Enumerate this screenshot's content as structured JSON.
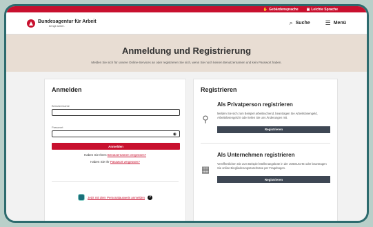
{
  "topbar": {
    "sign_language": "Gebärdensprache",
    "easy_language": "Leichte Sprache"
  },
  "header": {
    "org_name": "Bundesagentur für Arbeit",
    "tagline": "bringt weiter.",
    "search_label": "Suche",
    "menu_label": "Menü"
  },
  "hero": {
    "title": "Anmeldung und Registrierung",
    "subtitle": "Melden Sie sich für unsere Online-Services an oder registrieren Sie sich, wenn Sie noch keinen Benutzernamen und kein Passwort haben."
  },
  "login": {
    "heading": "Anmelden",
    "username_label": "Benutzername",
    "username_value": "",
    "password_label": "Passwort",
    "password_value": "",
    "submit_label": "Anmelden",
    "forgot_user_prefix": "Haben Sie Ihren ",
    "forgot_user_link": "Benutzernamen vergessen?",
    "forgot_pw_prefix": "Haben Sie Ihr ",
    "forgot_pw_link": "Passwort vergessen?",
    "eid_link": "Jetzt mit dem Personalausweis anmelden",
    "eid_help": "?"
  },
  "register": {
    "heading": "Registrieren",
    "private": {
      "title": "Als Privatperson registrieren",
      "text": "Melden Sie sich zum Beispiel arbeitsuchend, beantragen Sie Arbeitslosengeld, Arbeitslosengeld II oder teilen Sie uns Änderungen mit.",
      "button": "Registrieren",
      "icon": "person-icon"
    },
    "business": {
      "title": "Als Unternehmen registrieren",
      "text": "Veröffentlichen Sie zum Beispiel Stellenangebote in der JOBSUCHE oder beantragen Sie online Eingliederungszuschüsse per Fragebogen.",
      "button": "Registrieren",
      "icon": "building-icon"
    }
  },
  "colors": {
    "brand_red": "#c8102e",
    "dark_button": "#3e4754",
    "frame": "#2d6b6e"
  }
}
